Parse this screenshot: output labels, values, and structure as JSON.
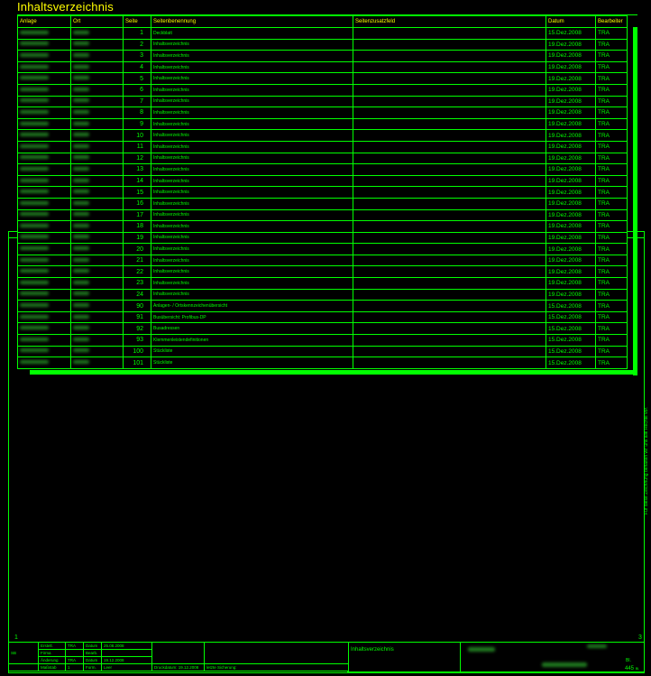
{
  "title": "Inhaltsverzeichnis",
  "table": {
    "headers": [
      "Anlage",
      "Ort",
      "Seite",
      "Seitenbenennung",
      "Seitenzusatzfeld",
      "Datum",
      "Bearbeiter"
    ],
    "rows": [
      {
        "seite": "1",
        "name": "Deckblatt",
        "datum": "15.Dez.2008",
        "bearb": "TRA"
      },
      {
        "seite": "2",
        "name": "Inhaltsverzeichnis",
        "datum": "19.Dez.2008",
        "bearb": "TRA"
      },
      {
        "seite": "3",
        "name": "Inhaltsverzeichnis",
        "datum": "19.Dez.2008",
        "bearb": "TRA"
      },
      {
        "seite": "4",
        "name": "Inhaltsverzeichnis",
        "datum": "19.Dez.2008",
        "bearb": "TRA"
      },
      {
        "seite": "5",
        "name": "Inhaltsverzeichnis",
        "datum": "19.Dez.2008",
        "bearb": "TRA"
      },
      {
        "seite": "6",
        "name": "Inhaltsverzeichnis",
        "datum": "19.Dez.2008",
        "bearb": "TRA"
      },
      {
        "seite": "7",
        "name": "Inhaltsverzeichnis",
        "datum": "19.Dez.2008",
        "bearb": "TRA"
      },
      {
        "seite": "8",
        "name": "Inhaltsverzeichnis",
        "datum": "19.Dez.2008",
        "bearb": "TRA"
      },
      {
        "seite": "9",
        "name": "Inhaltsverzeichnis",
        "datum": "19.Dez.2008",
        "bearb": "TRA"
      },
      {
        "seite": "10",
        "name": "Inhaltsverzeichnis",
        "datum": "19.Dez.2008",
        "bearb": "TRA"
      },
      {
        "seite": "11",
        "name": "Inhaltsverzeichnis",
        "datum": "19.Dez.2008",
        "bearb": "TRA"
      },
      {
        "seite": "12",
        "name": "Inhaltsverzeichnis",
        "datum": "19.Dez.2008",
        "bearb": "TRA"
      },
      {
        "seite": "13",
        "name": "Inhaltsverzeichnis",
        "datum": "19.Dez.2008",
        "bearb": "TRA"
      },
      {
        "seite": "14",
        "name": "Inhaltsverzeichnis",
        "datum": "19.Dez.2008",
        "bearb": "TRA"
      },
      {
        "seite": "15",
        "name": "Inhaltsverzeichnis",
        "datum": "19.Dez.2008",
        "bearb": "TRA"
      },
      {
        "seite": "16",
        "name": "Inhaltsverzeichnis",
        "datum": "19.Dez.2008",
        "bearb": "TRA"
      },
      {
        "seite": "17",
        "name": "Inhaltsverzeichnis",
        "datum": "19.Dez.2008",
        "bearb": "TRA"
      },
      {
        "seite": "18",
        "name": "Inhaltsverzeichnis",
        "datum": "19.Dez.2008",
        "bearb": "TRA"
      },
      {
        "seite": "19",
        "name": "Inhaltsverzeichnis",
        "datum": "19.Dez.2008",
        "bearb": "TRA"
      },
      {
        "seite": "20",
        "name": "Inhaltsverzeichnis",
        "datum": "19.Dez.2008",
        "bearb": "TRA"
      },
      {
        "seite": "21",
        "name": "Inhaltsverzeichnis",
        "datum": "19.Dez.2008",
        "bearb": "TRA"
      },
      {
        "seite": "22",
        "name": "Inhaltsverzeichnis",
        "datum": "19.Dez.2008",
        "bearb": "TRA"
      },
      {
        "seite": "23",
        "name": "Inhaltsverzeichnis",
        "datum": "19.Dez.2008",
        "bearb": "TRA"
      },
      {
        "seite": "24",
        "name": "Inhaltsverzeichnis",
        "datum": "19.Dez.2008",
        "bearb": "TRA"
      },
      {
        "seite": "90",
        "name": "Anlagen- / Ortskennzeichenübersicht",
        "datum": "15.Dez.2008",
        "bearb": "TRA"
      },
      {
        "seite": "91",
        "name": "Busübersicht: Profibus-DP",
        "datum": "15.Dez.2008",
        "bearb": "TRA"
      },
      {
        "seite": "92",
        "name": "Busadressen",
        "datum": "15.Dez.2008",
        "bearb": "TRA"
      },
      {
        "seite": "93",
        "name": "Klemmenleistendefinitionen",
        "datum": "15.Dez.2008",
        "bearb": "TRA"
      },
      {
        "seite": "100",
        "name": "Stückliste",
        "datum": "15.Dez.2008",
        "bearb": "TRA"
      },
      {
        "seite": "101",
        "name": "Stückliste",
        "datum": "15.Dez.2008",
        "bearb": "TRA"
      }
    ]
  },
  "ruler": [
    "0",
    "1",
    "2",
    "3",
    "4",
    "5",
    "6",
    "7",
    "8",
    "9"
  ],
  "corners": {
    "bottom_left": "1",
    "bottom_right": "3"
  },
  "side_note": "Für diese Zeichnung behalten wir uns alle Rechte vor.",
  "title_block": {
    "sb": "SB",
    "rows": [
      {
        "label": "Erstell.",
        "who": "TRA",
        "dlabel": "Datum",
        "date": "25.08.2008"
      },
      {
        "label": "Firma",
        "who": "",
        "dlabel": "Bearb.",
        "date": ""
      },
      {
        "label": "Änderung",
        "who": "TRA",
        "dlabel": "Datum",
        "date": "19.12.2008"
      },
      {
        "label": "Maßstab",
        "who": "1",
        "dlabel": "Form.",
        "date": "Leer"
      }
    ],
    "druckdatum": "Druckdatum: 19.12.2008",
    "sicherung": "letzte Sicherung:",
    "center_title": "Inhaltsverzeichnis",
    "bl_label": "Bl.",
    "sheet": "445",
    "sheet_suffix": "Bl."
  },
  "colors": {
    "line": "#00ff00",
    "title": "#ffff00",
    "background": "#000000"
  }
}
